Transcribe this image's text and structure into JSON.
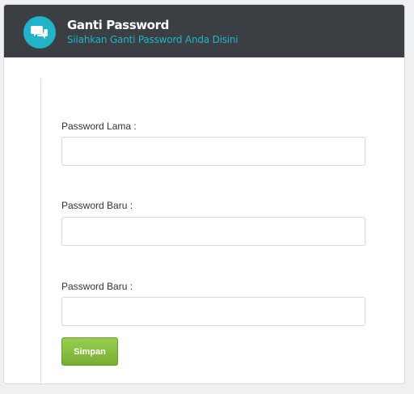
{
  "header": {
    "title": "Ganti Password",
    "subtitle": "Silahkan Ganti Password Anda Disini",
    "icon": "chat-bubbles-icon",
    "accent_color": "#22b2c9",
    "background_color": "#3b3f43"
  },
  "form": {
    "fields": [
      {
        "label": "Password Lama :",
        "value": "",
        "placeholder": ""
      },
      {
        "label": "Password Baru :",
        "value": "",
        "placeholder": ""
      },
      {
        "label": "Password Baru :",
        "value": "",
        "placeholder": ""
      }
    ],
    "submit_label": "Simpan",
    "submit_color": "#8cc14b"
  }
}
